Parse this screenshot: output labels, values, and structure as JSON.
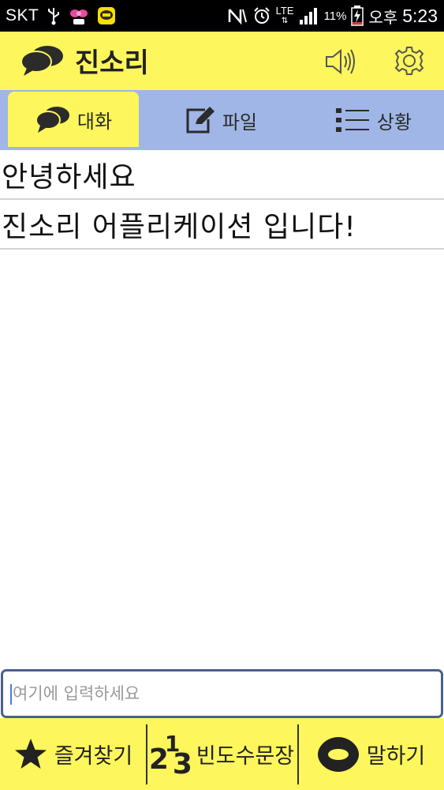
{
  "status_bar": {
    "carrier": "SKT",
    "network": "LTE",
    "battery": "11%",
    "ampm": "오후",
    "time": "5:23"
  },
  "app": {
    "title": "진소리",
    "accent_color": "#fdf65c",
    "tab_color": "#9fb6e6"
  },
  "tabs": [
    {
      "label": "대화",
      "icon": "chat-bubbles-icon",
      "active": true
    },
    {
      "label": "파일",
      "icon": "edit-note-icon",
      "active": false
    },
    {
      "label": "상황",
      "icon": "list-icon",
      "active": false
    }
  ],
  "messages": [
    {
      "text": "안녕하세요"
    },
    {
      "text": "진소리 어플리케이션 입니다!"
    }
  ],
  "input": {
    "placeholder": "여기에 입력하세요",
    "value": ""
  },
  "bottom_bar": {
    "favorites_label": "즐겨찾기",
    "frequent_label": "빈도수문장",
    "speak_label": "말하기",
    "frequent_icon_digits": [
      "2",
      "1",
      "3"
    ]
  }
}
